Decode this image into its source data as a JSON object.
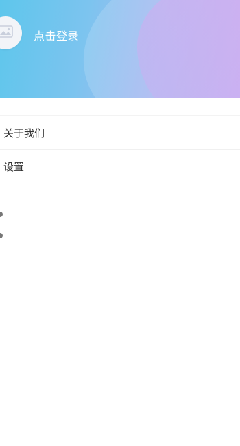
{
  "header": {
    "login_label": "点击登录",
    "gradient": [
      "#5ec6ec",
      "#a8b8f0",
      "#c8aef0"
    ]
  },
  "avatar": {
    "icon": "image-placeholder-icon"
  },
  "menu": {
    "items": [
      {
        "label": "关于我们"
      },
      {
        "label": "设置"
      }
    ]
  }
}
